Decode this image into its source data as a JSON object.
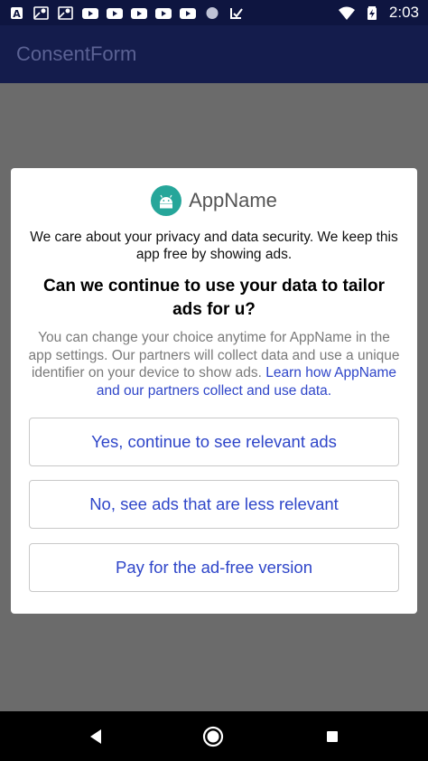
{
  "status_bar": {
    "time": "2:03",
    "left_icons": [
      "a-box-icon",
      "maps-icon",
      "maps-icon",
      "youtube-icon",
      "youtube-icon",
      "youtube-icon",
      "youtube-icon",
      "youtube-icon",
      "circle-icon",
      "check-icon"
    ],
    "right_icons": [
      "wifi-icon",
      "battery-charging-icon"
    ]
  },
  "app_bar": {
    "title": "ConsentForm"
  },
  "dialog": {
    "app_name": "AppName",
    "app_icon": "android-icon",
    "intro": "We care about your privacy and data security. We keep this app free by showing ads.",
    "question": "Can we continue to use your data to tailor ads for u?",
    "details_text": "You can change your choice anytime for AppName in the app settings. Our partners will collect data and use a unique identifier on your device to show ads. ",
    "details_link": "Learn how AppName and our partners collect and use data.",
    "buttons": {
      "yes": "Yes, continue to see relevant ads",
      "no": "No, see ads that are less relevant",
      "pay": "Pay for the ad-free version"
    }
  },
  "nav_bar": {
    "icons": [
      "back-icon",
      "home-icon",
      "recents-icon"
    ]
  },
  "colors": {
    "status_bar": "#0e1540",
    "app_bar": "#141c4c",
    "app_title": "#5b6294",
    "scrim": "#6b6b6b",
    "accent": "#2f46c9",
    "app_icon_bg": "#26a69a"
  }
}
